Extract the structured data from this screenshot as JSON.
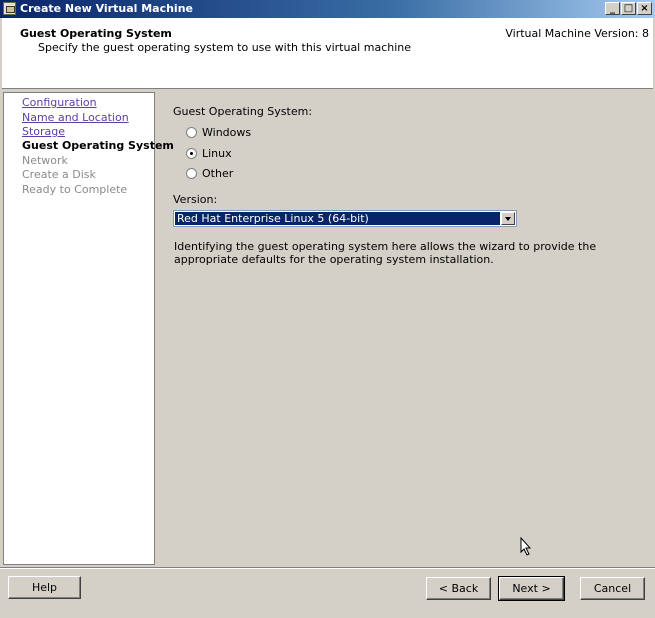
{
  "window": {
    "title": "Create New Virtual Machine",
    "icon": "vm-wizard-icon",
    "controls": {
      "minimize": "_",
      "maximize": "□",
      "close": "×"
    }
  },
  "header": {
    "title": "Guest Operating System",
    "subtitle": "Specify the guest operating system to use with this virtual machine",
    "version": "Virtual Machine Version: 8"
  },
  "steps": [
    {
      "label": "Configuration",
      "state": "link"
    },
    {
      "label": "Name and Location",
      "state": "link"
    },
    {
      "label": "Storage",
      "state": "link"
    },
    {
      "label": "Guest Operating System",
      "state": "current"
    },
    {
      "label": "Network",
      "state": "disabled"
    },
    {
      "label": "Create a Disk",
      "state": "disabled"
    },
    {
      "label": "Ready to Complete",
      "state": "disabled"
    }
  ],
  "form": {
    "os_label": "Guest Operating System:",
    "os_options": [
      {
        "label": "Windows",
        "checked": false
      },
      {
        "label": "Linux",
        "checked": true
      },
      {
        "label": "Other",
        "checked": false
      }
    ],
    "version_label": "Version:",
    "version_value": "Red Hat Enterprise Linux 5 (64-bit)",
    "description": "Identifying the guest operating system here allows the wizard to provide the appropriate defaults for the operating system installation."
  },
  "buttons": {
    "help": "Help",
    "back": "< Back",
    "next": "Next >",
    "cancel": "Cancel"
  },
  "colors": {
    "titlebar": "#0a246a",
    "link": "#5c3fa8",
    "selection": "#0a246a"
  }
}
